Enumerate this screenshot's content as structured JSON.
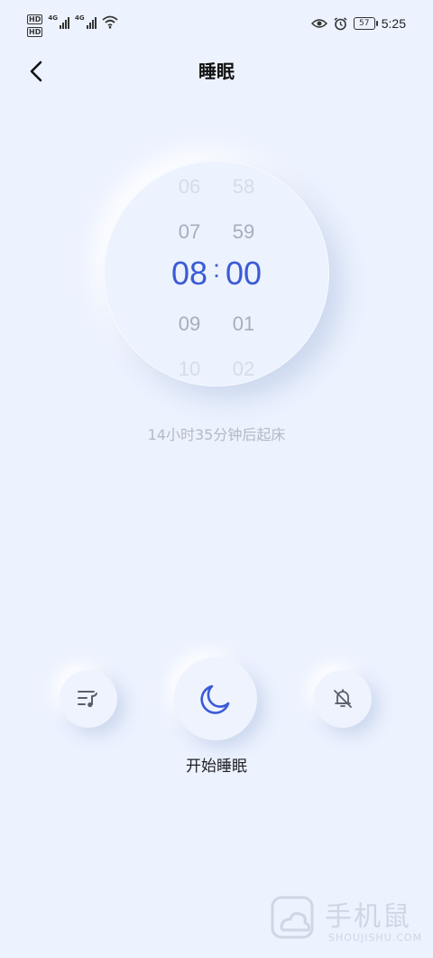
{
  "status_bar": {
    "hd_1": "HD",
    "hd_2": "HD",
    "net_1": "4G",
    "net_2": "4G",
    "battery": "57",
    "time": "5:25"
  },
  "header": {
    "title": "睡眠"
  },
  "picker": {
    "hours": [
      "06",
      "07",
      "08",
      "09",
      "10"
    ],
    "minutes": [
      "58",
      "59",
      "00",
      "01",
      "02"
    ],
    "selected_hour": "08",
    "selected_minute": "00",
    "separator": ":"
  },
  "wake_hint": "14小时35分钟后起床",
  "controls": {
    "start_label": "开始睡眠"
  },
  "watermark": {
    "cn": "手机鼠",
    "en": "SHOUJISHU.COM"
  },
  "colors": {
    "background": "#ecf2fe",
    "accent": "#3b5bd5",
    "muted_text": "#b4bac5"
  }
}
